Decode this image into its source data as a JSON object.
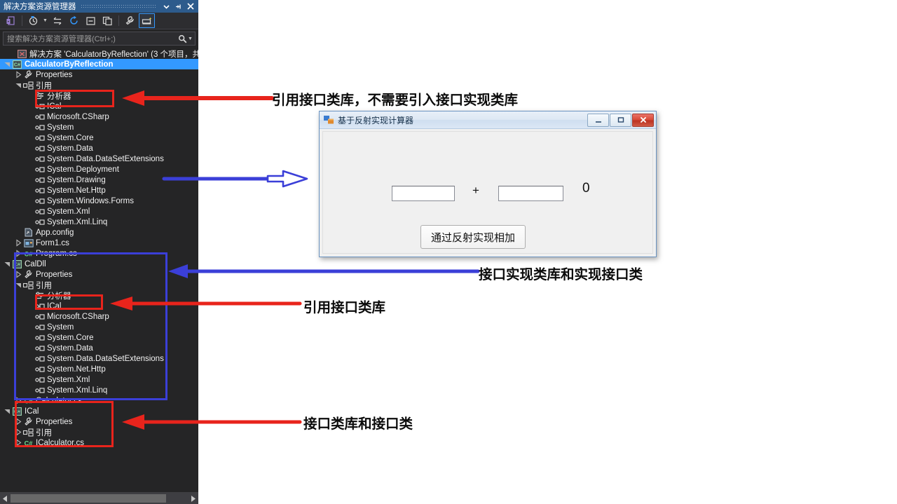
{
  "solution_explorer": {
    "title": "解决方案资源管理器",
    "titlebar_buttons": [
      {
        "name": "window-dropdown-icon",
        "label": "▾"
      },
      {
        "name": "pin-icon",
        "label": "⊣"
      },
      {
        "name": "close-icon",
        "label": "✕"
      }
    ],
    "toolbar": [
      {
        "name": "home-icon",
        "label": "properties-window"
      },
      {
        "name": "pending-changes-icon",
        "label": "pending-changes"
      },
      {
        "name": "toolbar-dropdown-icon",
        "label": "▾"
      },
      {
        "name": "sync-icon",
        "label": "sync-with-active-document"
      },
      {
        "name": "refresh-icon",
        "label": "refresh"
      },
      {
        "name": "collapse-all-icon",
        "label": "collapse-all"
      },
      {
        "name": "show-all-files-icon",
        "label": "show-all-files"
      },
      {
        "name": "properties-wrench-icon",
        "label": "properties"
      },
      {
        "name": "preview-selected-items-icon",
        "label": "preview-selected-items"
      }
    ],
    "search": {
      "placeholder": "搜索解决方案资源管理器(Ctrl+;)",
      "value": ""
    },
    "solution_line": "解决方案 'CalculatorByReflection' (3 个项目，共",
    "tree": [
      {
        "depth": 1,
        "twisty": "expanded",
        "icon": "csharp-project-icon",
        "label": "CalculatorByReflection",
        "selected": true
      },
      {
        "depth": 2,
        "twisty": "collapsed",
        "icon": "wrench-icon",
        "label": "Properties"
      },
      {
        "depth": 2,
        "twisty": "expanded",
        "icon": "references-icon",
        "label": "引用"
      },
      {
        "depth": 3,
        "twisty": "none",
        "icon": "analyzer-icon",
        "label": "分析器"
      },
      {
        "depth": 3,
        "twisty": "none",
        "icon": "reference-icon",
        "label": "ICal"
      },
      {
        "depth": 3,
        "twisty": "none",
        "icon": "reference-icon",
        "label": "Microsoft.CSharp"
      },
      {
        "depth": 3,
        "twisty": "none",
        "icon": "reference-icon",
        "label": "System"
      },
      {
        "depth": 3,
        "twisty": "none",
        "icon": "reference-icon",
        "label": "System.Core"
      },
      {
        "depth": 3,
        "twisty": "none",
        "icon": "reference-icon",
        "label": "System.Data"
      },
      {
        "depth": 3,
        "twisty": "none",
        "icon": "reference-icon",
        "label": "System.Data.DataSetExtensions"
      },
      {
        "depth": 3,
        "twisty": "none",
        "icon": "reference-icon",
        "label": "System.Deployment"
      },
      {
        "depth": 3,
        "twisty": "none",
        "icon": "reference-icon",
        "label": "System.Drawing"
      },
      {
        "depth": 3,
        "twisty": "none",
        "icon": "reference-icon",
        "label": "System.Net.Http"
      },
      {
        "depth": 3,
        "twisty": "none",
        "icon": "reference-icon",
        "label": "System.Windows.Forms"
      },
      {
        "depth": 3,
        "twisty": "none",
        "icon": "reference-icon",
        "label": "System.Xml"
      },
      {
        "depth": 3,
        "twisty": "none",
        "icon": "reference-icon",
        "label": "System.Xml.Linq"
      },
      {
        "depth": 2,
        "twisty": "none",
        "icon": "config-icon",
        "label": "App.config"
      },
      {
        "depth": 2,
        "twisty": "collapsed",
        "icon": "form-icon",
        "label": "Form1.cs"
      },
      {
        "depth": 2,
        "twisty": "collapsed",
        "icon": "csharp-file-icon",
        "label": "Program.cs"
      },
      {
        "depth": 1,
        "twisty": "expanded",
        "icon": "csharp-project-icon",
        "label": "CalDll"
      },
      {
        "depth": 2,
        "twisty": "collapsed",
        "icon": "wrench-icon",
        "label": "Properties"
      },
      {
        "depth": 2,
        "twisty": "expanded",
        "icon": "references-icon",
        "label": "引用"
      },
      {
        "depth": 3,
        "twisty": "none",
        "icon": "analyzer-icon",
        "label": "分析器"
      },
      {
        "depth": 3,
        "twisty": "none",
        "icon": "reference-icon",
        "label": "ICal"
      },
      {
        "depth": 3,
        "twisty": "none",
        "icon": "reference-icon",
        "label": "Microsoft.CSharp"
      },
      {
        "depth": 3,
        "twisty": "none",
        "icon": "reference-icon",
        "label": "System"
      },
      {
        "depth": 3,
        "twisty": "none",
        "icon": "reference-icon",
        "label": "System.Core"
      },
      {
        "depth": 3,
        "twisty": "none",
        "icon": "reference-icon",
        "label": "System.Data"
      },
      {
        "depth": 3,
        "twisty": "none",
        "icon": "reference-icon",
        "label": "System.Data.DataSetExtensions"
      },
      {
        "depth": 3,
        "twisty": "none",
        "icon": "reference-icon",
        "label": "System.Net.Http"
      },
      {
        "depth": 3,
        "twisty": "none",
        "icon": "reference-icon",
        "label": "System.Xml"
      },
      {
        "depth": 3,
        "twisty": "none",
        "icon": "reference-icon",
        "label": "System.Xml.Linq"
      },
      {
        "depth": 2,
        "twisty": "collapsed",
        "icon": "csharp-file-icon",
        "label": "Calculator.cs"
      },
      {
        "depth": 1,
        "twisty": "expanded",
        "icon": "csharp-project-icon",
        "label": "ICal"
      },
      {
        "depth": 2,
        "twisty": "collapsed",
        "icon": "wrench-icon",
        "label": "Properties"
      },
      {
        "depth": 2,
        "twisty": "collapsed",
        "icon": "references-icon",
        "label": "引用"
      },
      {
        "depth": 2,
        "twisty": "collapsed",
        "icon": "csharp-file-icon",
        "label": "ICalculator.cs"
      }
    ]
  },
  "calculator_window": {
    "title": "基于反射实现计算器",
    "input_a": "",
    "input_b": "",
    "operator": "+",
    "result": "0",
    "button_label": "通过反射实现相加",
    "window_buttons": [
      {
        "name": "minimize-button",
        "label": "—"
      },
      {
        "name": "maximize-button",
        "label": "▢"
      },
      {
        "name": "close-button",
        "label": "✕"
      }
    ]
  },
  "annotations": [
    {
      "id": "anno-1",
      "text": "引用接口类库，不需要引入接口实现类库",
      "color": "#0b0b0b"
    },
    {
      "id": "anno-2",
      "text": "接口实现类库和实现接口类",
      "color": "#0b0b0b"
    },
    {
      "id": "anno-3",
      "text": "引用接口类库",
      "color": "#0b0b0b"
    },
    {
      "id": "anno-4",
      "text": "接口类库和接口类",
      "color": "#0b0b0b"
    }
  ],
  "colors": {
    "red_highlight": "#e8241c",
    "blue_highlight": "#3b3fd8",
    "selection_blue": "#3399ff",
    "panel_background": "#252526",
    "titlebar_blue": "#2d5b8c"
  }
}
